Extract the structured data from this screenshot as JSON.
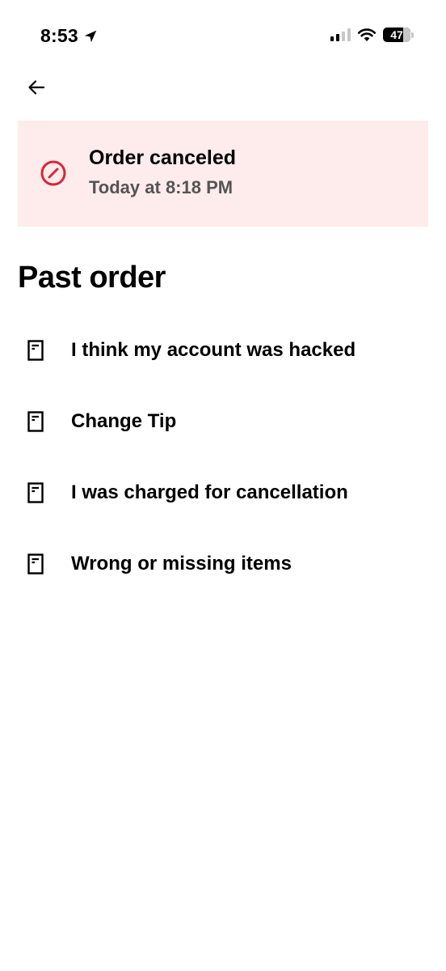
{
  "status_bar": {
    "time": "8:53",
    "battery_level": "47",
    "location_icon": "location-arrow-icon",
    "signal_icon": "cellular-signal-icon",
    "wifi_icon": "wifi-icon"
  },
  "header": {
    "back_icon": "back-arrow-icon"
  },
  "order_status": {
    "title": "Order canceled",
    "time": "Today at 8:18 PM",
    "icon": "canceled-icon",
    "background_color": "#fdeceb",
    "icon_color": "#d6263a"
  },
  "section": {
    "title": "Past order"
  },
  "help_topics": [
    {
      "label": "I think my account was hacked",
      "icon": "document-icon"
    },
    {
      "label": "Change Tip",
      "icon": "document-icon"
    },
    {
      "label": "I was charged for cancellation",
      "icon": "document-icon"
    },
    {
      "label": "Wrong or missing items",
      "icon": "document-icon"
    }
  ]
}
